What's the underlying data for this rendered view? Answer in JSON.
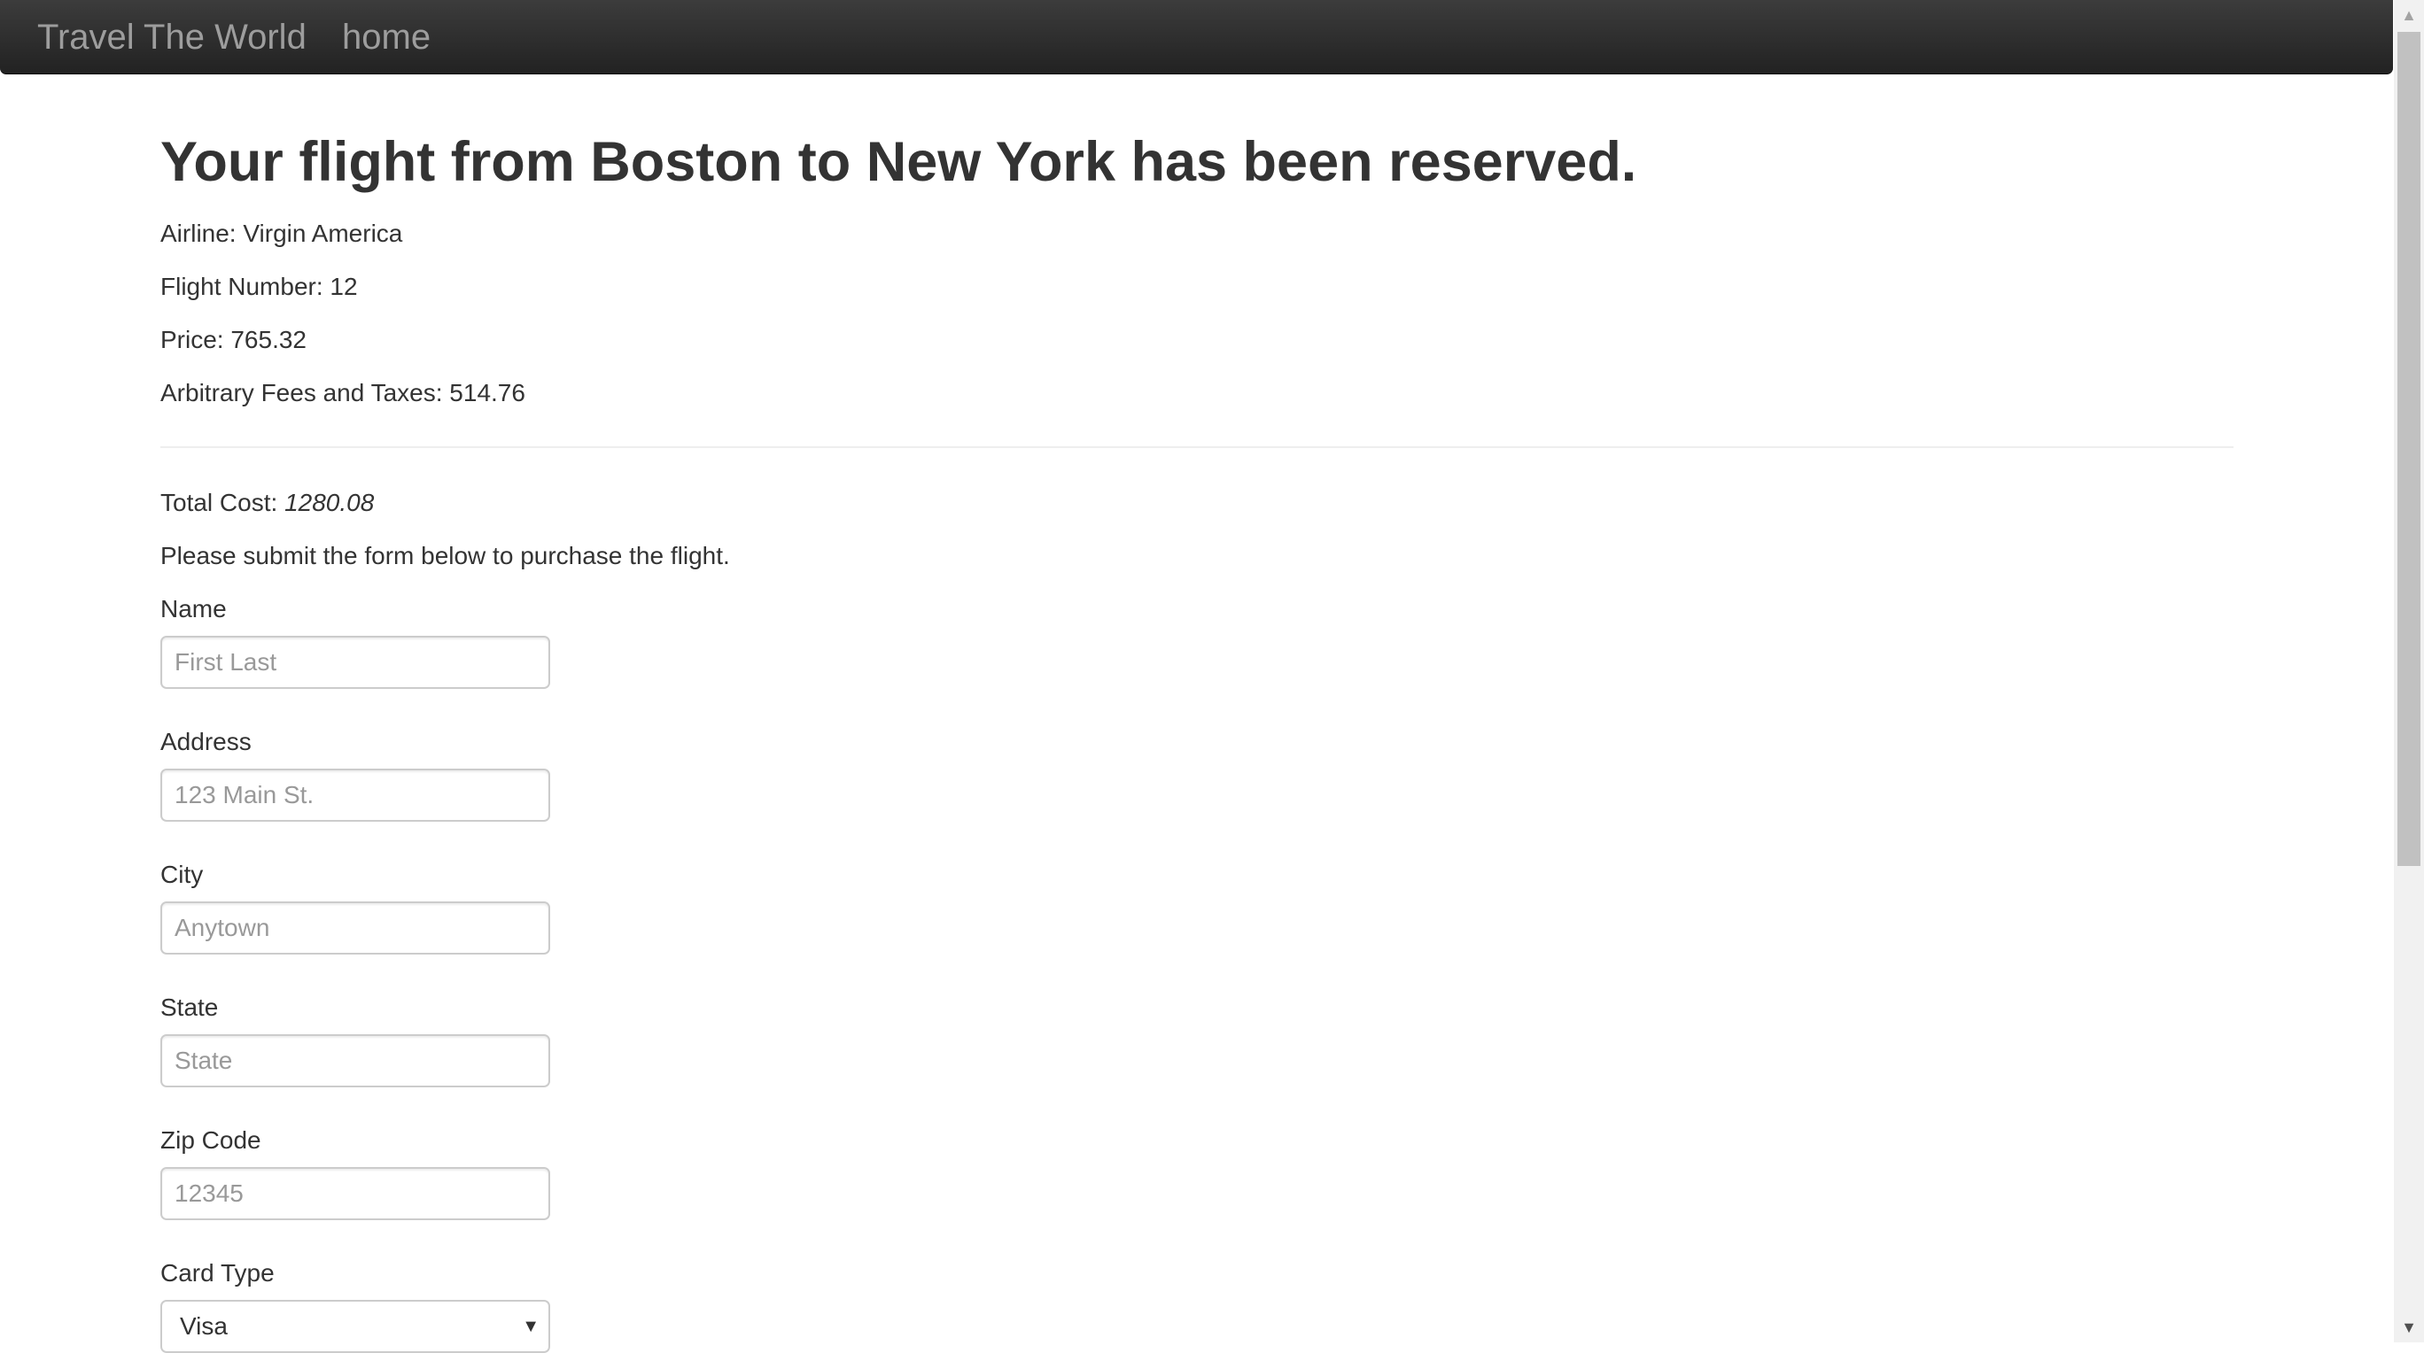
{
  "navbar": {
    "brand": "Travel The World",
    "home_link": "home"
  },
  "reservation": {
    "heading": "Your flight from Boston to New York has been reserved.",
    "airline": "Airline: Virgin America",
    "flight_number": "Flight Number: 12",
    "price": "Price: 765.32",
    "fees": "Arbitrary Fees and Taxes: 514.76",
    "total_label": "Total Cost: ",
    "total_value": "1280.08",
    "instructions": "Please submit the form below to purchase the flight."
  },
  "form": {
    "name": {
      "label": "Name",
      "placeholder": "First Last",
      "value": ""
    },
    "address": {
      "label": "Address",
      "placeholder": "123 Main St.",
      "value": ""
    },
    "city": {
      "label": "City",
      "placeholder": "Anytown",
      "value": ""
    },
    "state": {
      "label": "State",
      "placeholder": "State",
      "value": ""
    },
    "zip": {
      "label": "Zip Code",
      "placeholder": "12345",
      "value": ""
    },
    "card_type": {
      "label": "Card Type",
      "selected": "Visa"
    }
  },
  "icons": {
    "select_arrow": "chevron-down-icon",
    "scroll_up": "arrow-up-icon",
    "scroll_down": "arrow-down-icon"
  }
}
